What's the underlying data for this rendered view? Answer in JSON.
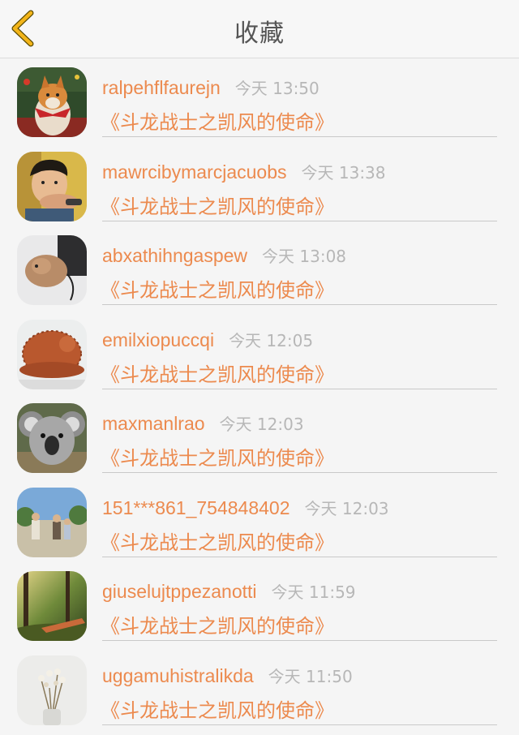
{
  "header": {
    "title": "收藏",
    "back_icon": "chevron-left-icon",
    "accent": "#f3b51a"
  },
  "favorites": [
    {
      "user": "ralpehflfaurejn",
      "time": "今天 13:50",
      "book": "《斗龙战士之凯风的使命》",
      "avatar": "shiba-dog-christmas"
    },
    {
      "user": "mawrcibymarcjacuobs",
      "time": "今天 13:38",
      "book": "《斗龙战士之凯风的使命》",
      "avatar": "child-portrait"
    },
    {
      "user": "abxathihngaspew",
      "time": "今天 13:08",
      "book": "《斗龙战士之凯风的使命》",
      "avatar": "small-animal"
    },
    {
      "user": "emilxiopuccqi",
      "time": "今天 12:05",
      "book": "《斗龙战士之凯风的使命》",
      "avatar": "knitted-hat"
    },
    {
      "user": "maxmanlrao",
      "time": "今天 12:03",
      "book": "《斗龙战士之凯风的使命》",
      "avatar": "koala"
    },
    {
      "user": "151***861_754848402",
      "time": "今天 12:03",
      "book": "《斗龙战士之凯风的使命》",
      "avatar": "park-people"
    },
    {
      "user": "giuselujtppezanotti",
      "time": "今天 11:59",
      "book": "《斗龙战士之凯风的使命》",
      "avatar": "forest-sunlight"
    },
    {
      "user": "uggamuhistralikda",
      "time": "今天 11:50",
      "book": "《斗龙战士之凯风的使命》",
      "avatar": "dried-flowers"
    }
  ],
  "colors": {
    "accent_text": "#ec8a4e",
    "time_text": "#b7b7b7",
    "background": "#f5f5f5"
  }
}
